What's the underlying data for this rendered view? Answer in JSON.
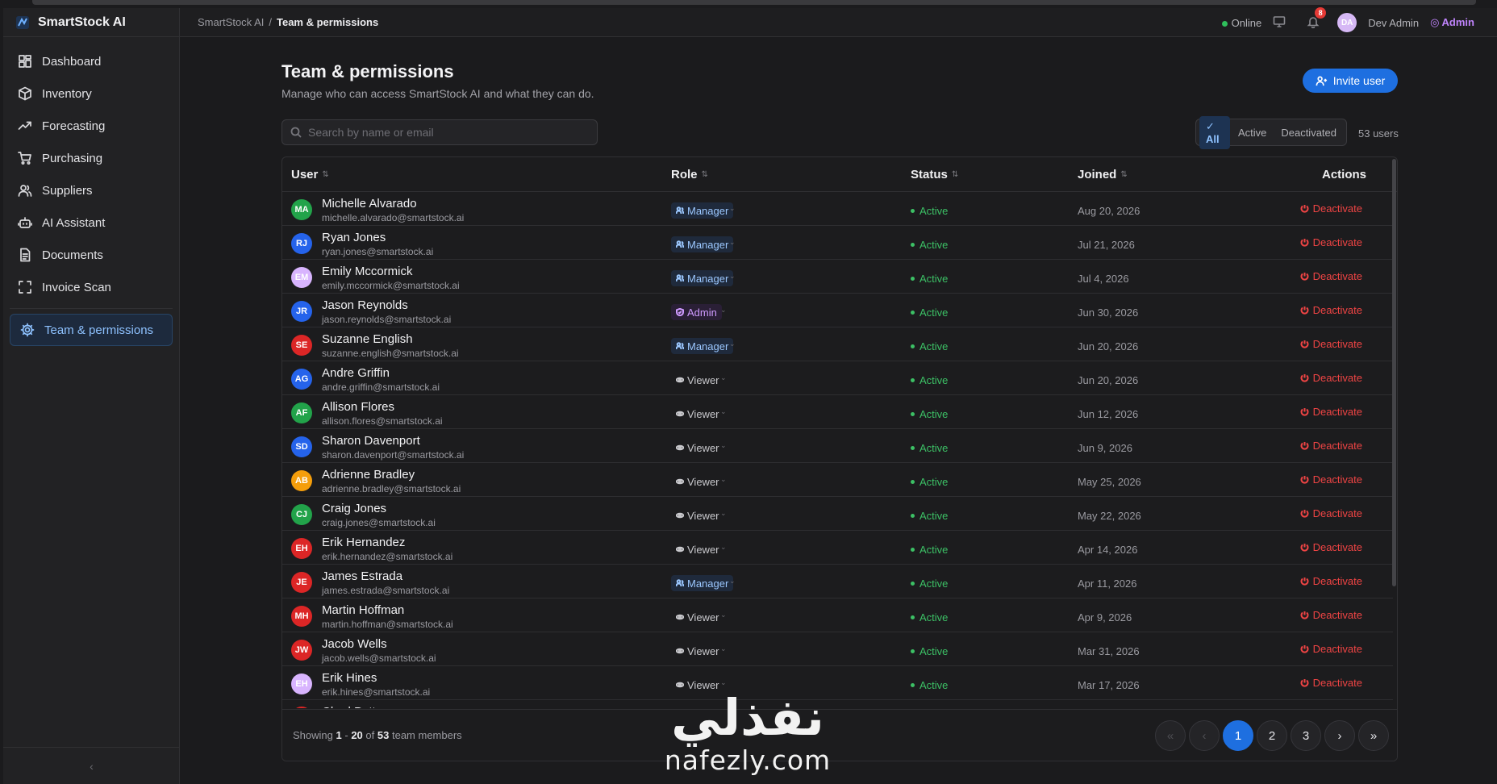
{
  "app": {
    "name": "SmartStock AI"
  },
  "sidebar": {
    "items": [
      {
        "label": "Dashboard",
        "icon": "dashboard-icon"
      },
      {
        "label": "Inventory",
        "icon": "box-icon"
      },
      {
        "label": "Forecasting",
        "icon": "trend-icon"
      },
      {
        "label": "Purchasing",
        "icon": "cart-icon"
      },
      {
        "label": "Suppliers",
        "icon": "users-icon"
      },
      {
        "label": "AI Assistant",
        "icon": "bot-icon"
      },
      {
        "label": "Documents",
        "icon": "document-icon"
      },
      {
        "label": "Invoice Scan",
        "icon": "scan-icon"
      }
    ],
    "active_item": {
      "label": "Team & permissions",
      "icon": "gear-icon"
    },
    "collapse_glyph": "‹"
  },
  "header": {
    "breadcrumb": {
      "root": "SmartStock AI",
      "sep": "/",
      "current": "Team & permissions"
    },
    "online": "Online",
    "notifications": "8",
    "user_initials": "DA",
    "user_name": "Dev Admin",
    "user_role": "Admin"
  },
  "page": {
    "title": "Team & permissions",
    "subtitle": "Manage who can access SmartStock AI and what they can do.",
    "invite_label": "Invite user",
    "search_placeholder": "Search by name or email",
    "filters": {
      "all": "All",
      "active": "Active",
      "deactivated": "Deactivated"
    },
    "user_count": "53 users"
  },
  "table": {
    "columns": {
      "user": "User",
      "role": "Role",
      "status": "Status",
      "joined": "Joined",
      "actions": "Actions"
    },
    "rows": [
      {
        "initials": "MA",
        "color": "#22a34a",
        "name": "Michelle Alvarado",
        "email": "michelle.alvarado@smartstock.ai",
        "role": "Manager",
        "status": "Active",
        "joined": "Aug 20, 2026",
        "action": "Deactivate"
      },
      {
        "initials": "RJ",
        "color": "#2563eb",
        "name": "Ryan Jones",
        "email": "ryan.jones@smartstock.ai",
        "role": "Manager",
        "status": "Active",
        "joined": "Jul 21, 2026",
        "action": "Deactivate"
      },
      {
        "initials": "EM",
        "color": "#d8b4fe",
        "name": "Emily Mccormick",
        "email": "emily.mccormick@smartstock.ai",
        "role": "Manager",
        "status": "Active",
        "joined": "Jul 4, 2026",
        "action": "Deactivate"
      },
      {
        "initials": "JR",
        "color": "#2563eb",
        "name": "Jason Reynolds",
        "email": "jason.reynolds@smartstock.ai",
        "role": "Admin",
        "status": "Active",
        "joined": "Jun 30, 2026",
        "action": "Deactivate"
      },
      {
        "initials": "SE",
        "color": "#dc2626",
        "name": "Suzanne English",
        "email": "suzanne.english@smartstock.ai",
        "role": "Manager",
        "status": "Active",
        "joined": "Jun 20, 2026",
        "action": "Deactivate"
      },
      {
        "initials": "AG",
        "color": "#2563eb",
        "name": "Andre Griffin",
        "email": "andre.griffin@smartstock.ai",
        "role": "Viewer",
        "status": "Active",
        "joined": "Jun 20, 2026",
        "action": "Deactivate"
      },
      {
        "initials": "AF",
        "color": "#22a34a",
        "name": "Allison Flores",
        "email": "allison.flores@smartstock.ai",
        "role": "Viewer",
        "status": "Active",
        "joined": "Jun 12, 2026",
        "action": "Deactivate"
      },
      {
        "initials": "SD",
        "color": "#2563eb",
        "name": "Sharon Davenport",
        "email": "sharon.davenport@smartstock.ai",
        "role": "Viewer",
        "status": "Active",
        "joined": "Jun 9, 2026",
        "action": "Deactivate"
      },
      {
        "initials": "AB",
        "color": "#f59e0b",
        "name": "Adrienne Bradley",
        "email": "adrienne.bradley@smartstock.ai",
        "role": "Viewer",
        "status": "Active",
        "joined": "May 25, 2026",
        "action": "Deactivate"
      },
      {
        "initials": "CJ",
        "color": "#22a34a",
        "name": "Craig Jones",
        "email": "craig.jones@smartstock.ai",
        "role": "Viewer",
        "status": "Active",
        "joined": "May 22, 2026",
        "action": "Deactivate"
      },
      {
        "initials": "EH",
        "color": "#dc2626",
        "name": "Erik Hernandez",
        "email": "erik.hernandez@smartstock.ai",
        "role": "Viewer",
        "status": "Active",
        "joined": "Apr 14, 2026",
        "action": "Deactivate"
      },
      {
        "initials": "JE",
        "color": "#dc2626",
        "name": "James Estrada",
        "email": "james.estrada@smartstock.ai",
        "role": "Manager",
        "status": "Active",
        "joined": "Apr 11, 2026",
        "action": "Deactivate"
      },
      {
        "initials": "MH",
        "color": "#dc2626",
        "name": "Martin Hoffman",
        "email": "martin.hoffman@smartstock.ai",
        "role": "Viewer",
        "status": "Active",
        "joined": "Apr 9, 2026",
        "action": "Deactivate"
      },
      {
        "initials": "JW",
        "color": "#dc2626",
        "name": "Jacob Wells",
        "email": "jacob.wells@smartstock.ai",
        "role": "Viewer",
        "status": "Active",
        "joined": "Mar 31, 2026",
        "action": "Deactivate"
      },
      {
        "initials": "EH",
        "color": "#d8b4fe",
        "name": "Erik Hines",
        "email": "erik.hines@smartstock.ai",
        "role": "Viewer",
        "status": "Active",
        "joined": "Mar 17, 2026",
        "action": "Deactivate"
      }
    ],
    "partial_row": {
      "name": "Chad Petty",
      "color": "#dc2626"
    }
  },
  "footer": {
    "showing_prefix": "Showing",
    "range_start": "1",
    "range_sep": "-",
    "range_end": "20",
    "of": "of",
    "total": "53",
    "suffix": "team members",
    "pages": [
      "1",
      "2",
      "3"
    ],
    "first": "«",
    "prev": "‹",
    "next": "›",
    "last": "»"
  },
  "watermark": {
    "arabic": "نفذلي",
    "latin": "nafezly.com"
  }
}
